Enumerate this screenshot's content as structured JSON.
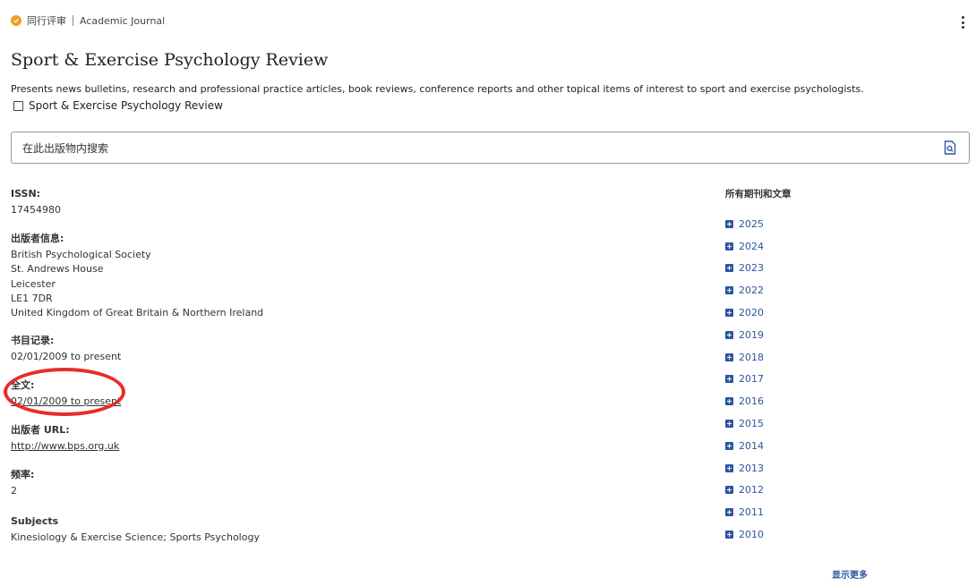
{
  "header": {
    "peer_review_label": "同行评审",
    "type_label": "Academic Journal"
  },
  "publication": {
    "title": "Sport & Exercise Psychology Review",
    "description": "Presents news bulletins, research and professional practice articles, book reviews, conference reports and other topical items of interest to sport and exercise psychologists.",
    "checkbox_label": "Sport & Exercise Psychology Review"
  },
  "search": {
    "placeholder": "在此出版物内搜索"
  },
  "details": {
    "issn_label": "ISSN:",
    "issn_value": "17454980",
    "publisher_label": "出版者信息:",
    "publisher_lines": [
      "British Psychological Society",
      "St. Andrews House",
      "Leicester",
      "LE1 7DR",
      "United Kingdom of Great Britain & Northern Ireland"
    ],
    "bib_label": "书目记录:",
    "bib_value": "02/01/2009 to present",
    "fulltext_label": "全文:",
    "fulltext_value": "02/01/2009 to present",
    "url_label": "出版者 URL:",
    "url_value": "http://www.bps.org.uk",
    "freq_label": "频率:",
    "freq_value": "2",
    "subjects_label": "Subjects",
    "subjects_value": "Kinesiology & Exercise Science; Sports Psychology"
  },
  "issues": {
    "title": "所有期刊和文章",
    "years": [
      "2025",
      "2024",
      "2023",
      "2022",
      "2020",
      "2019",
      "2018",
      "2017",
      "2016",
      "2015",
      "2014",
      "2013",
      "2012",
      "2011",
      "2010"
    ],
    "show_more": "显示更多"
  },
  "colors": {
    "link": "#2a56a0",
    "peer_badge": "#f0a020",
    "annotation": "#e82c2c"
  }
}
